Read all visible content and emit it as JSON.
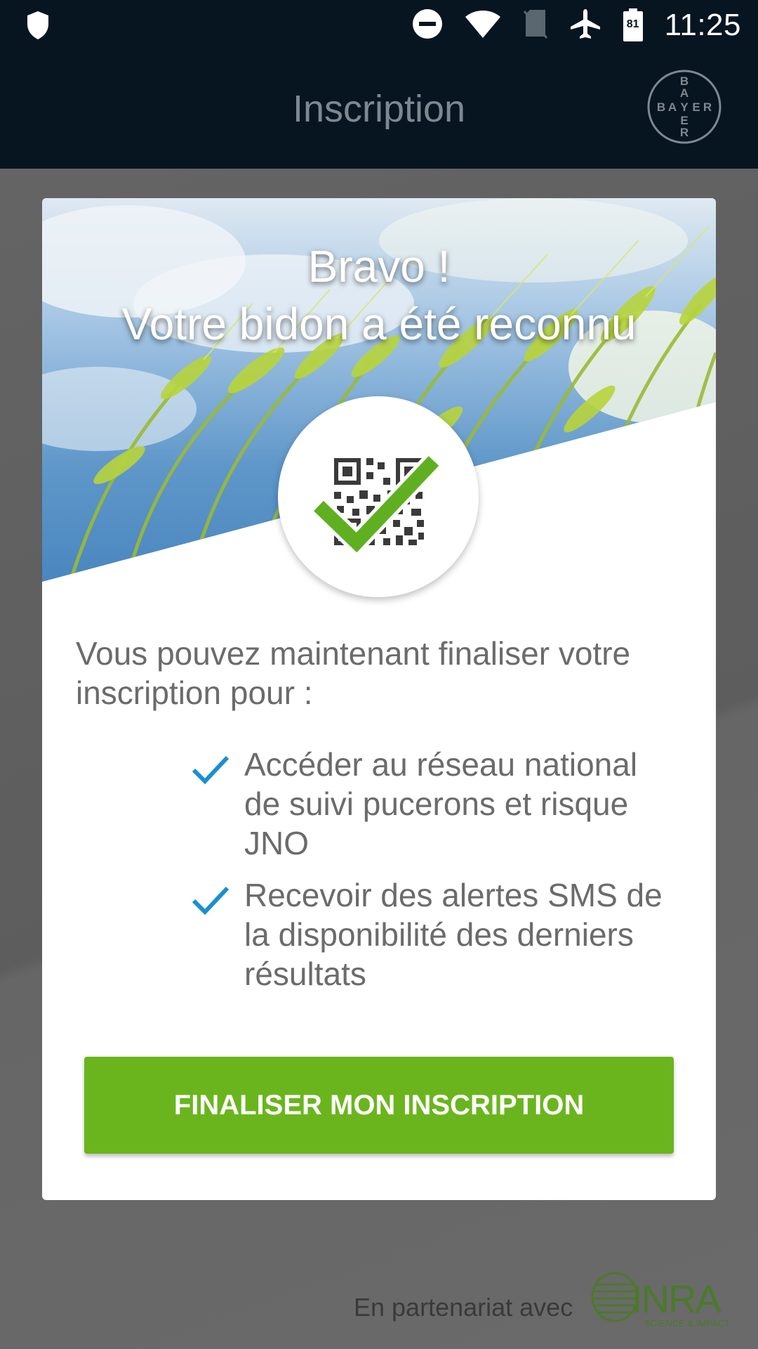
{
  "status_bar": {
    "time": "11:25",
    "battery_level": "81",
    "icons": [
      "shield-icon",
      "do-not-disturb-icon",
      "wifi-icon",
      "no-sim-icon",
      "airplane-mode-icon",
      "battery-icon"
    ]
  },
  "app_bar": {
    "title": "Inscription",
    "logo_letters": [
      "B",
      "A",
      "Y",
      "E",
      "R"
    ]
  },
  "hero": {
    "title_line1": "Bravo !",
    "title_line2": "Votre bidon a été reconnu",
    "badge_icon": "qr-code-check-icon"
  },
  "content": {
    "intro": "Vous pouvez maintenant finaliser votre inscription pour :",
    "features": [
      {
        "icon": "check-icon",
        "text": "Accéder au réseau national de suivi pucerons et risque JNO"
      },
      {
        "icon": "check-icon",
        "text": "Recevoir des alertes SMS de la disponibilité des derniers résultats"
      }
    ],
    "cta_label": "FINALISER MON INSCRIPTION"
  },
  "footer": {
    "partner_text": "En partenariat avec",
    "partner_logo_text": "INRA",
    "partner_logo_tagline": "SCIENCE & IMPACT"
  },
  "colors": {
    "bar_background": "#061520",
    "accent_green": "#6ab51d",
    "check_blue": "#1a8fd1",
    "text_gray": "#6b6b6b"
  }
}
